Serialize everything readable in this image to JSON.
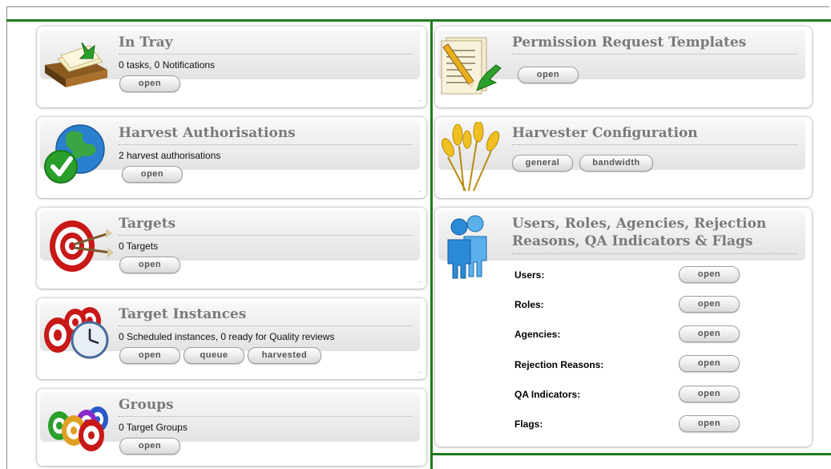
{
  "left": {
    "in_tray": {
      "title": "In Tray",
      "subtitle": "0 tasks, 0 Notifications",
      "buttons": [
        "open"
      ]
    },
    "harvest_auth": {
      "title": "Harvest Authorisations",
      "subtitle": "2 harvest authorisations",
      "buttons": [
        "open"
      ]
    },
    "targets": {
      "title": "Targets",
      "subtitle": "0 Targets",
      "buttons": [
        "open"
      ]
    },
    "target_instances": {
      "title": "Target Instances",
      "subtitle": "0 Scheduled instances, 0 ready for Quality reviews",
      "buttons": [
        "open",
        "queue",
        "harvested"
      ]
    },
    "groups": {
      "title": "Groups",
      "subtitle": "0 Target Groups",
      "buttons": [
        "open"
      ]
    }
  },
  "right": {
    "permission_templates": {
      "title": "Permission Request Templates",
      "buttons": [
        "open"
      ]
    },
    "harvester_config": {
      "title": "Harvester Configuration",
      "buttons": [
        "general",
        "bandwidth"
      ]
    },
    "users_roles": {
      "title_line1": "Users, Roles, Agencies, Rejection",
      "title_line2": "Reasons, QA Indicators & Flags",
      "rows": [
        {
          "label": "Users:",
          "button": "open"
        },
        {
          "label": "Roles:",
          "button": "open"
        },
        {
          "label": "Agencies:",
          "button": "open"
        },
        {
          "label": "Rejection Reasons:",
          "button": "open"
        },
        {
          "label": "QA Indicators:",
          "button": "open"
        },
        {
          "label": "Flags:",
          "button": "open"
        }
      ]
    }
  },
  "corner_mark": "."
}
